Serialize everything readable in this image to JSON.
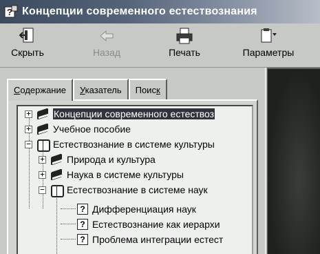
{
  "window": {
    "title": "Концепции современного естествознания"
  },
  "toolbar": {
    "items": [
      {
        "label": "Скрыть",
        "icon": "hide-pane-icon",
        "enabled": true
      },
      {
        "label": "Назад",
        "icon": "back-arrow-icon",
        "enabled": false
      },
      {
        "label": "Печать",
        "icon": "printer-icon",
        "enabled": true
      },
      {
        "label": "Параметры",
        "icon": "options-icon",
        "enabled": true
      }
    ]
  },
  "tabs": [
    {
      "label_u": "С",
      "label_rest": "одержание"
    },
    {
      "label_u": "У",
      "label_rest": "казатель"
    },
    {
      "label_pre": "Поис",
      "label_u": "к"
    }
  ],
  "tree": {
    "items": [
      {
        "label": "Концепции современного естествоз",
        "icon": "book-closed-icon",
        "expander": "+",
        "selected": true
      },
      {
        "label": "Учебное пособие",
        "icon": "book-closed-icon",
        "expander": "+"
      },
      {
        "label": "Естествознание в системе культуры",
        "icon": "book-open-icon",
        "expander": "−"
      },
      {
        "label": "Природа и культура",
        "icon": "book-closed-icon",
        "expander": "+"
      },
      {
        "label": "Наука в системе культуры",
        "icon": "book-closed-icon",
        "expander": "+"
      },
      {
        "label": "Естествознание в системе наук",
        "icon": "book-open-icon",
        "expander": "−"
      },
      {
        "label": "Дифференциация наук",
        "icon": "help-topic-icon"
      },
      {
        "label": "Естествознание как иерархи",
        "icon": "help-topic-icon"
      },
      {
        "label": "Проблема интеграции естест",
        "icon": "help-topic-icon"
      }
    ]
  }
}
